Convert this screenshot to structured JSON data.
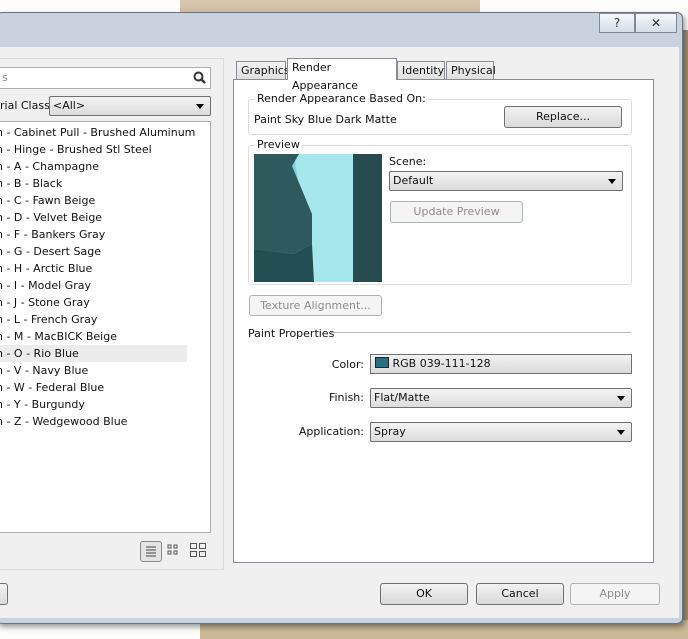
{
  "window": {
    "help_button": "?",
    "close_button": "✕"
  },
  "left": {
    "search_placeholder": "s",
    "class_label": "rial Class:",
    "class_value": "<All>",
    "materials": [
      "n - Cabinet Pull - Brushed Aluminum",
      "n - Hinge - Brushed Stl Steel",
      "n - A - Champagne",
      "n - B - Black",
      "n - C - Fawn Beige",
      "n - D - Velvet Beige",
      "n - F - Bankers Gray",
      "n - G - Desert Sage",
      "n - H - Arctic Blue",
      "n - I - Model Gray",
      "n - J - Stone Gray",
      "n - L - French Gray",
      "n - M - MacBICK Beige",
      "n - O - Rio Blue",
      "n - V - Navy Blue",
      "n - W - Federal Blue",
      "n - Y - Burgundy",
      "n - Z - Wedgewood Blue"
    ],
    "selected_index": 13
  },
  "tabs": [
    "Graphics",
    "Render Appearance",
    "Identity",
    "Physical"
  ],
  "active_tab": "Render Appearance",
  "render": {
    "based_on_label": "Render Appearance Based On:",
    "based_on_value": "Paint Sky Blue Dark Matte",
    "replace_button": "Replace...",
    "preview_label": "Preview",
    "scene_label": "Scene:",
    "scene_value": "Default",
    "update_preview_button": "Update Preview",
    "texture_alignment_button": "Texture Alignment...",
    "paint_properties_label": "Paint Properties",
    "color_label": "Color:",
    "color_value": "RGB 039-111-128",
    "color_swatch": "#276f80",
    "finish_label": "Finish:",
    "finish_value": "Flat/Matte",
    "application_label": "Application:",
    "application_value": "Spray"
  },
  "footer": {
    "ok": "OK",
    "cancel": "Cancel",
    "apply": "Apply"
  }
}
